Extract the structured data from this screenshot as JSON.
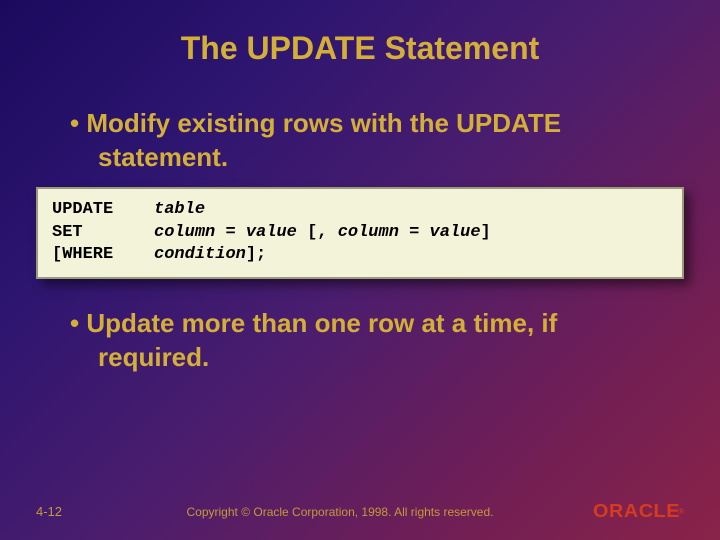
{
  "title": "The UPDATE Statement",
  "bullet1_line1": "• Modify existing rows with the UPDATE",
  "bullet1_line2": "statement.",
  "code": {
    "kw1": "UPDATE",
    "arg1": "table",
    "kw2": "SET",
    "arg2a": "column",
    "eq": " = ",
    "arg2b": "value",
    "arg2c": " [, ",
    "arg2d": "column",
    "arg2e": " = ",
    "arg2f": "value",
    "arg2g": "]",
    "kw3": "[WHERE",
    "arg3a": "condition",
    "arg3b": "];"
  },
  "bullet2_line1": "• Update more than one row at a time, if",
  "bullet2_line2": "required.",
  "footer": {
    "pagenum": "4-12",
    "copyright": "Copyright © Oracle Corporation, 1998. All rights reserved.",
    "logo": "ORACLE",
    "reg": "®"
  }
}
